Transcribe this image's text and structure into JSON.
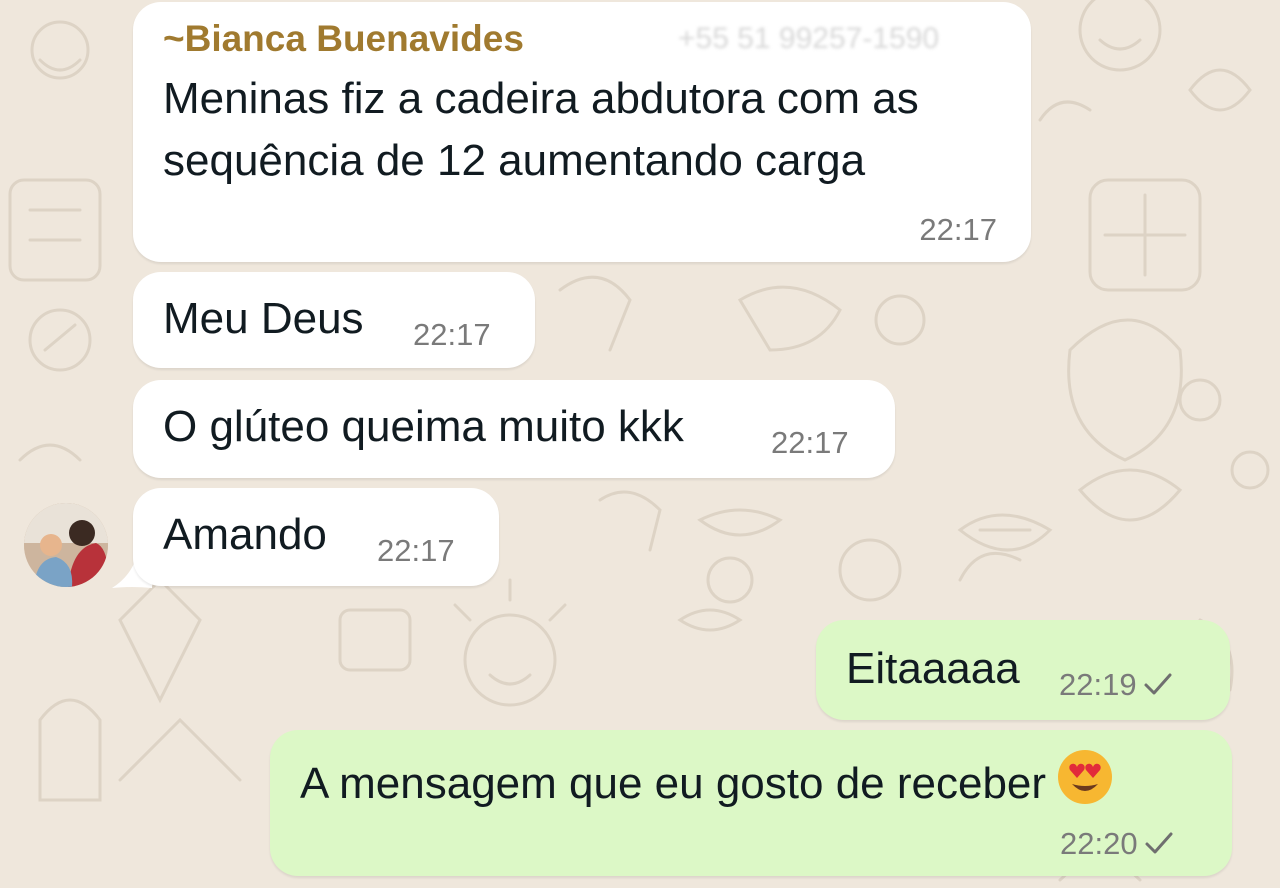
{
  "chat": {
    "messages": [
      {
        "direction": "in",
        "sender": "~Bianca Buenavides",
        "sender_phone": "+55 51 99257-1590",
        "lines": [
          "Meninas fiz a cadeira abdutora com as",
          "sequência de 12 aumentando carga"
        ],
        "time": "22:17"
      },
      {
        "direction": "in",
        "text": "Meu Deus",
        "time": "22:17"
      },
      {
        "direction": "in",
        "text": "O glúteo queima muito kkk",
        "time": "22:17"
      },
      {
        "direction": "in",
        "text": "Amando",
        "time": "22:17",
        "has_avatar": true
      },
      {
        "direction": "out",
        "text": "Eitaaaaa",
        "time": "22:19",
        "status": "sent-check"
      },
      {
        "direction": "out",
        "text": "A mensagem que eu gosto de receber",
        "emoji": "smiling-face-with-heart-eyes",
        "time": "22:20",
        "status": "sent-check"
      }
    ]
  },
  "colors": {
    "wallpaper": "#efe7dc",
    "incoming_bubble": "#ffffff",
    "outgoing_bubble": "#dcf8c6",
    "sender_name": "#a07a2f",
    "timestamp": "#7a7a7a"
  }
}
